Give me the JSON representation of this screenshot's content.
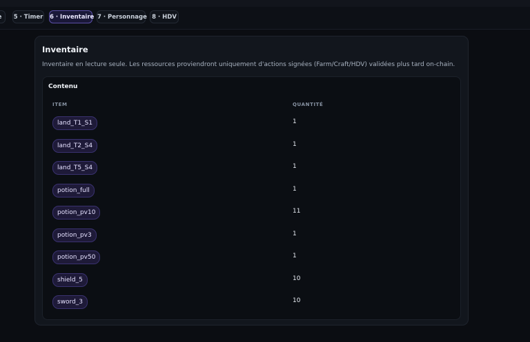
{
  "tabs": [
    {
      "label": "le",
      "active": false
    },
    {
      "label": "5 · Timer",
      "active": false
    },
    {
      "label": "6 · Inventaire",
      "active": true
    },
    {
      "label": "7 · Personnage",
      "active": false
    },
    {
      "label": "8 · HDV",
      "active": false
    }
  ],
  "card": {
    "title": "Inventaire",
    "description": "Inventaire en lecture seule. Les ressources proviendront uniquement d'actions signées (Farm/Craft/HDV) validées plus tard on-chain."
  },
  "panel": {
    "title": "Contenu",
    "columns": [
      "ITEM",
      "QUANTITÉ"
    ],
    "rows": [
      {
        "item": "land_T1_S1",
        "qty": "1"
      },
      {
        "item": "land_T2_S4",
        "qty": "1"
      },
      {
        "item": "land_T5_S4",
        "qty": "1"
      },
      {
        "item": "potion_full",
        "qty": "1"
      },
      {
        "item": "potion_pv10",
        "qty": "11"
      },
      {
        "item": "potion_pv3",
        "qty": "1"
      },
      {
        "item": "potion_pv50",
        "qty": "1"
      },
      {
        "item": "shield_5",
        "qty": "10"
      },
      {
        "item": "sword_3",
        "qty": "10"
      }
    ]
  },
  "colors": {
    "accent": "#5b4fa8",
    "chip_bg": "#1e1a38",
    "background": "#0b0d12"
  }
}
